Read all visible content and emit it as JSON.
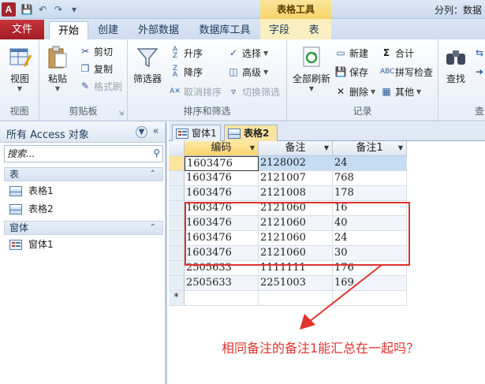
{
  "app": {
    "icon_letter": "A",
    "title": "分列：数据"
  },
  "context_group": {
    "label": "表格工具"
  },
  "tabs": {
    "file": "文件",
    "home": "开始",
    "create": "创建",
    "external": "外部数据",
    "dbtools": "数据库工具",
    "fields": "字段",
    "table": "表"
  },
  "ribbon": {
    "view": {
      "button": "视图",
      "group": "视图"
    },
    "clipboard": {
      "paste": "粘贴",
      "cut": "剪切",
      "copy": "复制",
      "format_painter": "格式刷",
      "group": "剪贴板"
    },
    "sort_filter": {
      "filter": "筛选器",
      "ascending": "升序",
      "descending": "降序",
      "remove_sort": "取消排序",
      "select": "选择",
      "advanced": "高级",
      "toggle_filter": "切换筛选",
      "group": "排序和筛选"
    },
    "records": {
      "refresh_all": "全部刷新",
      "new": "新建",
      "save": "保存",
      "delete": "删除",
      "totals": "合计",
      "spelling": "拼写检查",
      "more": "其他",
      "group": "记录"
    },
    "find": {
      "find": "查找",
      "group": "查"
    }
  },
  "nav": {
    "title": "所有 Access 对象",
    "search_placeholder": "搜索...",
    "sections": [
      {
        "label": "表",
        "items": [
          "表格1",
          "表格2"
        ]
      },
      {
        "label": "窗体",
        "items": [
          "窗体1"
        ]
      }
    ]
  },
  "doc_tabs": [
    "窗体1",
    "表格2"
  ],
  "table": {
    "columns": [
      "编码",
      "备注",
      "备注1"
    ],
    "rows": [
      [
        "1603476",
        "2128002",
        "24"
      ],
      [
        "1603476",
        "2121007",
        "768"
      ],
      [
        "1603476",
        "2121008",
        "178"
      ],
      [
        "1603476",
        "2121060",
        "16"
      ],
      [
        "1603476",
        "2121060",
        "40"
      ],
      [
        "1603476",
        "2121060",
        "24"
      ],
      [
        "1603476",
        "2121060",
        "30"
      ],
      [
        "2505633",
        "1111111",
        "176"
      ],
      [
        "2505633",
        "2251003",
        "169"
      ]
    ],
    "new_row_marker": "*"
  },
  "annotation": {
    "text": "相同备注的备注1能汇总在一起吗？",
    "color": "#e0332f"
  }
}
